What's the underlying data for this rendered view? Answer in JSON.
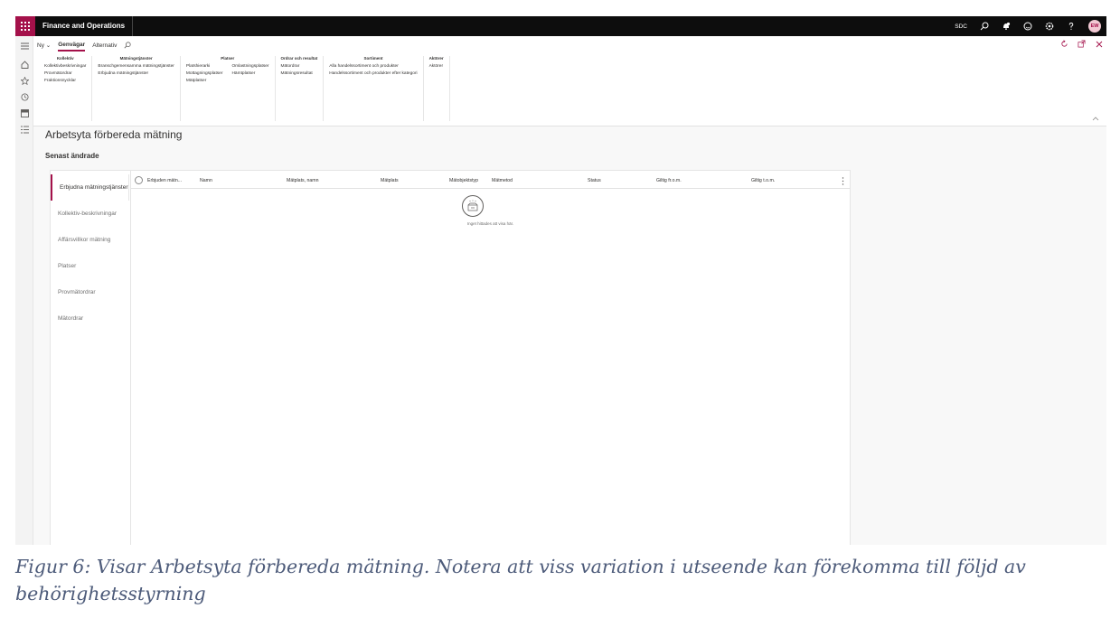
{
  "app": {
    "title": "Finance and Operations",
    "company": "SDC",
    "user_initials": "EW",
    "accent_color": "#a4114a",
    "topbar_color": "#0d0d0d"
  },
  "actionpane": {
    "tabs": [
      {
        "label": "Ny",
        "has_dropdown": true
      },
      {
        "label": "Genvägar",
        "active": true
      },
      {
        "label": "Alternativ"
      }
    ],
    "groups": [
      {
        "title": "Kollektiv",
        "columns": [
          [
            "Kollektivbeskrivningar",
            "Provmätordrar",
            "Fraktionsnycklar"
          ]
        ]
      },
      {
        "title": "Mätningstjänster",
        "columns": [
          [
            "Branschgemensamma mätningstjänster",
            "Erbjudna mätningstjänster"
          ]
        ]
      },
      {
        "title": "Platser",
        "columns": [
          [
            "Platshierarki",
            "Mottagningsplatser",
            "Mätplatser"
          ],
          [
            "Omlastningsplatser",
            "Hämtplatser"
          ]
        ]
      },
      {
        "title": "Ordrar och resultat",
        "columns": [
          [
            "Mätordrar",
            "Mätningsresultat"
          ]
        ]
      },
      {
        "title": "Sortiment",
        "columns": [
          [
            "Alla handelssortiment och produkter",
            "Handelssortiment och produkter efter kategori"
          ]
        ]
      },
      {
        "title": "Aktörer",
        "columns": [
          [
            "Aktörer"
          ]
        ]
      }
    ]
  },
  "workspace": {
    "title": "Arbetsyta förbereda mätning",
    "subtitle": "Senast ändrade",
    "vtabs": [
      {
        "label": "Erbjudna mätningstjänster",
        "active": true
      },
      {
        "label": "Kollektiv-beskrivningar"
      },
      {
        "label": "Affärsvillkor mätning"
      },
      {
        "label": "Platser"
      },
      {
        "label": "Provmätordrar"
      },
      {
        "label": "Mätordrar"
      }
    ],
    "grid": {
      "columns": [
        "Erbjuden mätn...",
        "Namn",
        "Mätplats, namn",
        "Mätplats",
        "Mätobjektstyp",
        "Mätmetod",
        "Status",
        "Giltig fr.o.m.",
        "Giltig t.o.m."
      ],
      "empty_text": "Inget hittades att visa här."
    }
  },
  "caption": "Figur 6: Visar Arbetsyta förbereda mätning. Notera att viss variation i utseende kan förekomma till följd av behörighetsstyrning"
}
